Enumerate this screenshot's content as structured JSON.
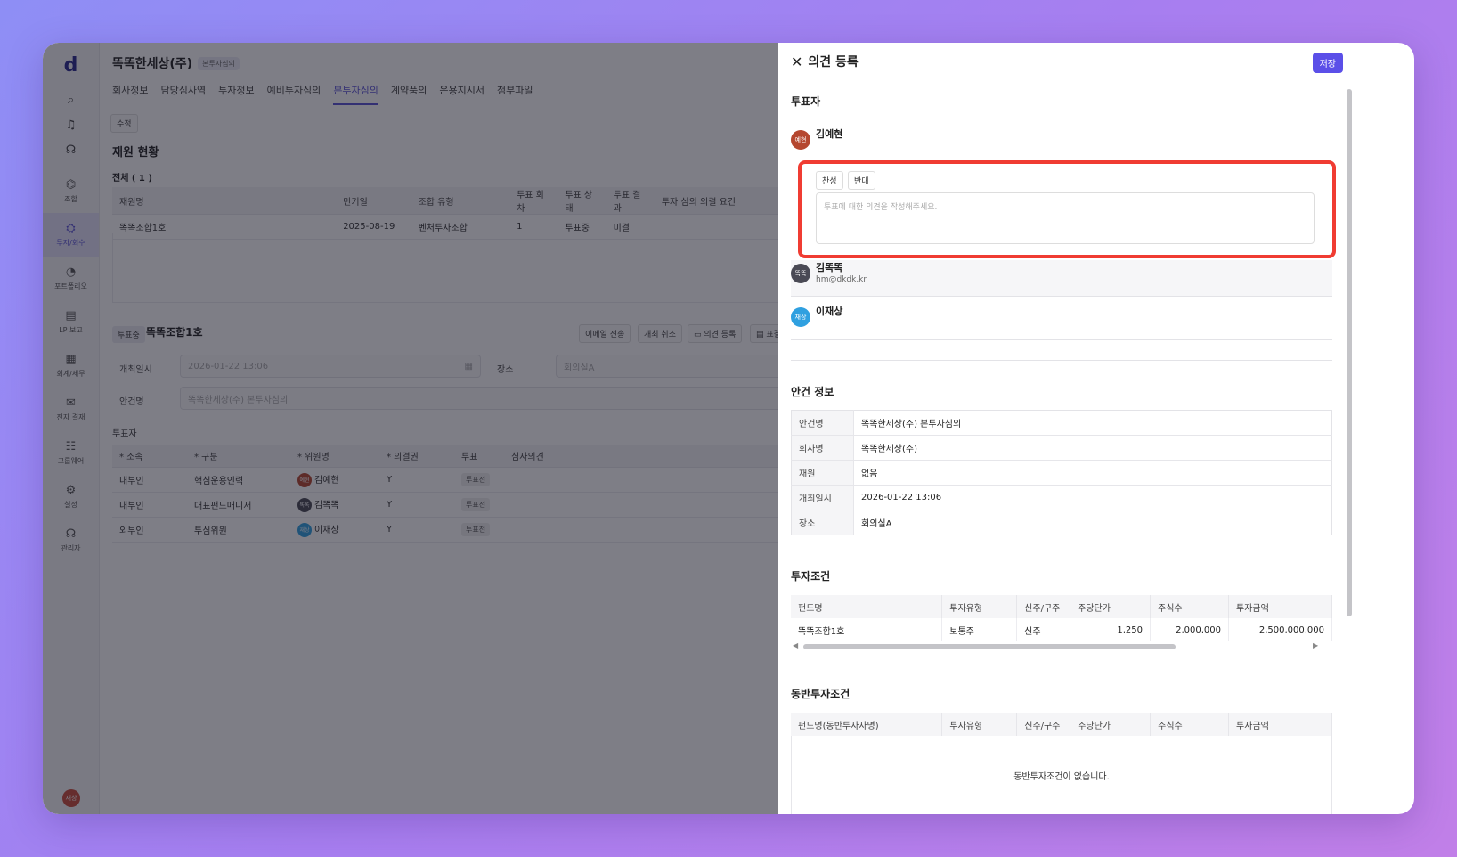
{
  "sidebar": {
    "logo": "d",
    "items": [
      {
        "icon": "network-icon",
        "glyph": "⌬",
        "label": "조합"
      },
      {
        "icon": "investment-icon",
        "glyph": "⛭",
        "label": "투자/회수"
      },
      {
        "icon": "portfolio-icon",
        "glyph": "◔",
        "label": "포트폴리오"
      },
      {
        "icon": "report-icon",
        "glyph": "▤",
        "label": "LP 보고"
      },
      {
        "icon": "accounting-icon",
        "glyph": "▦",
        "label": "회계/세무"
      },
      {
        "icon": "approval-icon",
        "glyph": "✉",
        "label": "전자 결재"
      },
      {
        "icon": "groupware-icon",
        "glyph": "☷",
        "label": "그룹웨어"
      },
      {
        "icon": "settings-icon",
        "glyph": "⚙",
        "label": "설정"
      },
      {
        "icon": "admin-icon",
        "glyph": "☊",
        "label": "관리자"
      }
    ],
    "avatar": "재상"
  },
  "main": {
    "title": "똑똑한세상(주)",
    "title_tag": "본투자심의",
    "tabs": [
      "회사정보",
      "담당심사역",
      "투자정보",
      "예비투자심의",
      "본투자심의",
      "계약품의",
      "운용지시서",
      "첨부파일"
    ],
    "edit_button": "수정",
    "fund_section": "재원 현황",
    "total": "전체 ( 1 )",
    "fund_table": {
      "headers": [
        "재원명",
        "만기일",
        "조합 유형",
        "투표 회차",
        "투표 상태",
        "투표 결과",
        "투자 심의 의결 요건"
      ],
      "rows": [
        [
          "똑똑조합1호",
          "2025-08-19",
          "벤처투자조합",
          "1",
          "투표중",
          "미결",
          ""
        ]
      ]
    },
    "vote_status_tag": "투표중",
    "vote_title": "똑똑조합1호",
    "actions": [
      "이메일 전송",
      "개최 취소",
      "의견 등록",
      "표결"
    ],
    "meeting_label": "개최일시",
    "meeting_value": "2026-01-22 13:06",
    "place_label": "장소",
    "place_value": "회의실A",
    "agenda_label": "안건명",
    "agenda_value": "똑똑한세상(주) 본투자심의",
    "voters_label": "투표자",
    "voter_table": {
      "headers": [
        "* 소속",
        "* 구분",
        "* 위원명",
        "* 의결권",
        "투표",
        "심사의견"
      ],
      "rows": [
        [
          "내부인",
          "핵심운용인력",
          "김예현",
          "Y",
          "투표전",
          ""
        ],
        [
          "내부인",
          "대표펀드매니저",
          "김똑똑",
          "Y",
          "투표전",
          ""
        ],
        [
          "외부인",
          "투심위원",
          "이재상",
          "Y",
          "투표전",
          ""
        ]
      ]
    }
  },
  "panel": {
    "title": "의견 등록",
    "save": "저장",
    "voters_heading": "투표자",
    "voters": [
      {
        "initial": "예현",
        "name": "김예현",
        "email": "",
        "color": "#b5472f"
      },
      {
        "initial": "똑똑",
        "name": "김똑똑",
        "email": "hm@dkdk.kr",
        "color": "#4a4a55"
      },
      {
        "initial": "재상",
        "name": "이재상",
        "email": "",
        "color": "#2fa0e0"
      }
    ],
    "approve": "찬성",
    "reject": "반대",
    "opinion_placeholder": "투표에 대한 의견을 작성해주세요.",
    "agenda_heading": "안건 정보",
    "agenda": [
      [
        "안건명",
        "똑똑한세상(주) 본투자심의"
      ],
      [
        "회사명",
        "똑똑한세상(주)"
      ],
      [
        "재원",
        "없음"
      ],
      [
        "개최일시",
        "2026-01-22 13:06"
      ],
      [
        "장소",
        "회의실A"
      ]
    ],
    "terms_heading": "투자조건",
    "terms": {
      "headers": [
        "펀드명",
        "투자유형",
        "신주/구주",
        "주당단가",
        "주식수",
        "투자금액"
      ],
      "rows": [
        [
          "똑똑조합1호",
          "보통주",
          "신주",
          "1,250",
          "2,000,000",
          "2,500,000,000"
        ]
      ]
    },
    "co_heading": "동반투자조건",
    "co": {
      "headers": [
        "펀드명(동반투자자명)",
        "투자유형",
        "신주/구주",
        "주당단가",
        "주식수",
        "투자금액"
      ],
      "empty": "동반투자조건이 없습니다."
    }
  }
}
